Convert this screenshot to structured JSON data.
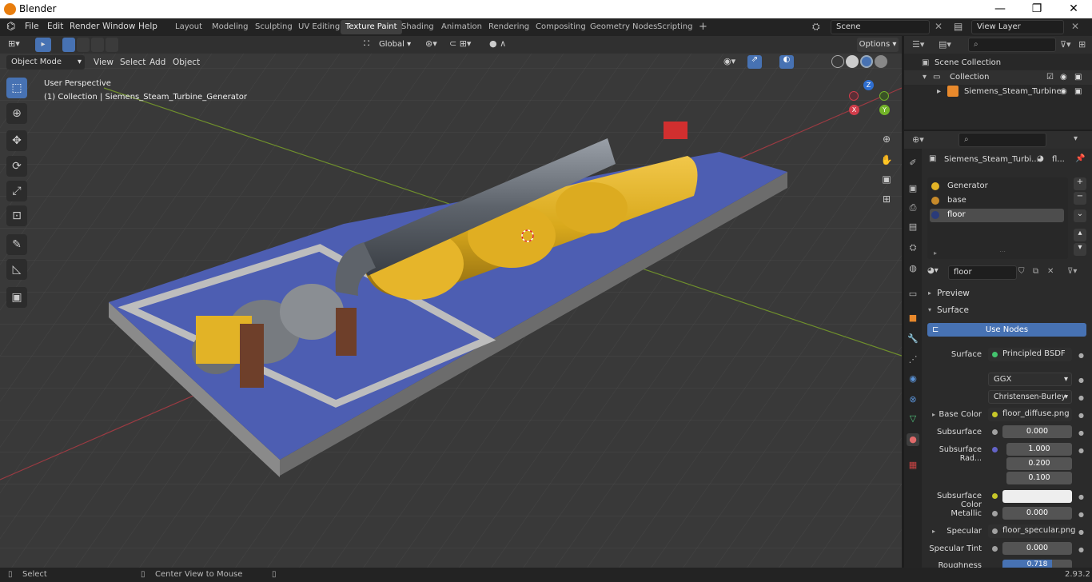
{
  "window": {
    "title": "Blender",
    "minimize": "—",
    "maximize": "❐",
    "close": "✕"
  },
  "menu": [
    "File",
    "Edit",
    "Render",
    "Window",
    "Help"
  ],
  "workspaces": [
    "Layout",
    "Modeling",
    "Sculpting",
    "UV Editing",
    "Texture Paint",
    "Shading",
    "Animation",
    "Rendering",
    "Compositing",
    "Geometry Nodes",
    "Scripting"
  ],
  "workspace_active": "Texture Paint",
  "scene": {
    "name": "Scene",
    "view_layer": "View Layer"
  },
  "viewport": {
    "mode": "Object Mode",
    "header_menu": [
      "View",
      "Select",
      "Add",
      "Object"
    ],
    "transform_orientation": "Global",
    "options_label": "Options",
    "overlay_line1": "User Perspective",
    "overlay_line2": "(1) Collection | Siemens_Steam_Turbine_Generator",
    "gizmo": {
      "x": "X",
      "y": "Y",
      "z": "Z"
    }
  },
  "outliner": {
    "scene_collection": "Scene Collection",
    "collection": "Collection",
    "object": "Siemens_Steam_Turbine"
  },
  "properties": {
    "object_name": "Siemens_Steam_Turbi...",
    "material_slot_short": "fl...",
    "material_slots": [
      "Generator",
      "base",
      "floor"
    ],
    "material_active": "floor",
    "material_name": "floor",
    "preview_label": "Preview",
    "surface_label": "Surface",
    "use_nodes_label": "Use Nodes",
    "surface": {
      "label": "Surface",
      "value": "Principled BSDF"
    },
    "distribution": "GGX",
    "subsurface_method": "Christensen-Burley",
    "base_color": {
      "label": "Base Color",
      "value": "floor_diffuse.png"
    },
    "subsurface": {
      "label": "Subsurface",
      "value": "0.000"
    },
    "subsurface_radius": {
      "label": "Subsurface Rad...",
      "values": [
        "1.000",
        "0.200",
        "0.100"
      ]
    },
    "subsurface_color": {
      "label": "Subsurface Color"
    },
    "metallic": {
      "label": "Metallic",
      "value": "0.000"
    },
    "specular": {
      "label": "Specular",
      "value": "floor_specular.png"
    },
    "specular_tint": {
      "label": "Specular Tint",
      "value": "0.000"
    },
    "roughness": {
      "label": "Roughness",
      "value": "0.718",
      "fraction": 0.718
    }
  },
  "status": {
    "select": "Select",
    "center": "Center View to Mouse",
    "version": "2.93.2"
  },
  "colors": {
    "accent": "#4772b3",
    "yellow": "#e2b326",
    "floor_blue": "#4a5cb0"
  }
}
